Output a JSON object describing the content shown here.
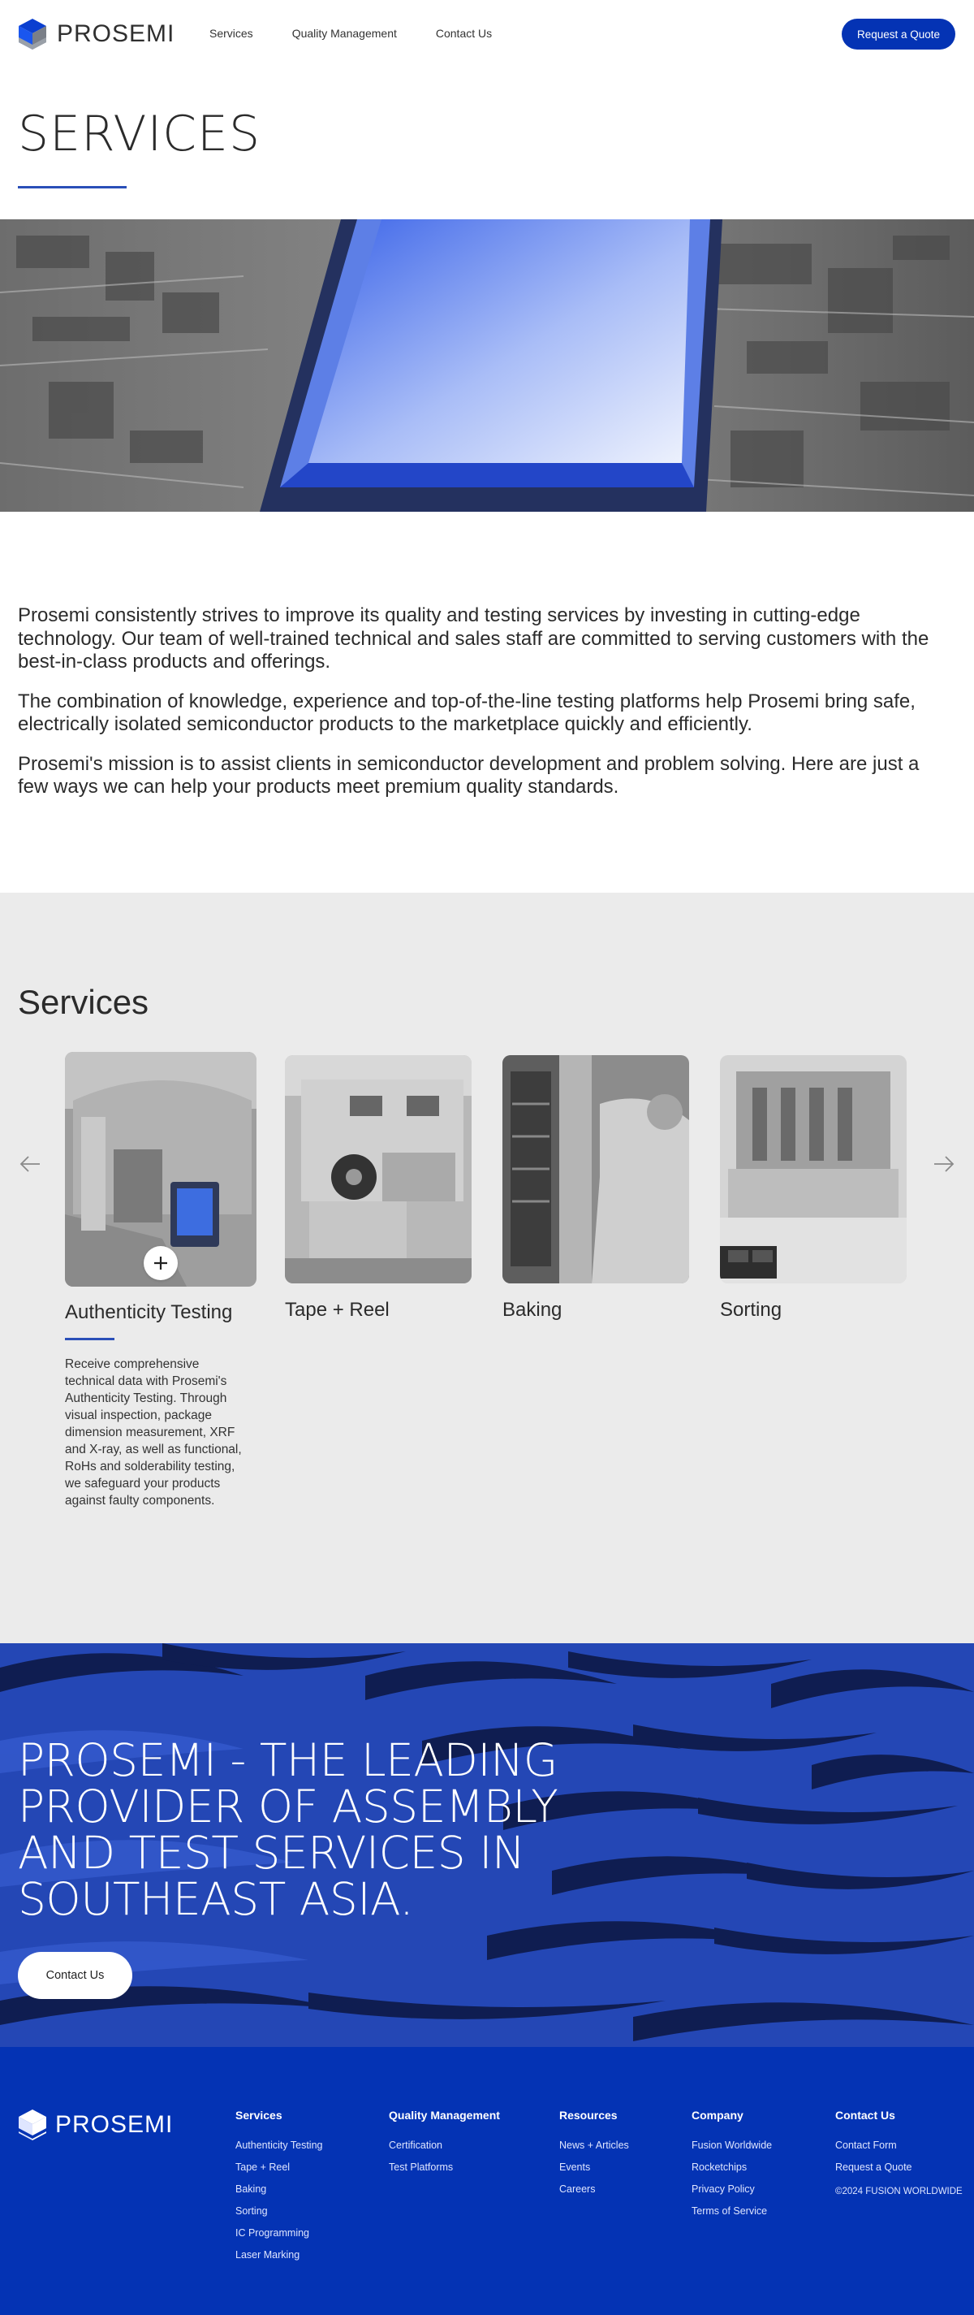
{
  "brand": {
    "name": "PROSEMI",
    "accent": "#0433b4",
    "rule_color": "#2a4fb8",
    "banner_color": "#2447b5"
  },
  "header": {
    "nav": [
      "Services",
      "Quality Management",
      "Contact Us"
    ],
    "cta_label": "Request a Quote"
  },
  "page": {
    "title": "SERVICES"
  },
  "intro": {
    "paragraphs": [
      "Prosemi consistently strives to improve its quality and testing services by investing in cutting-edge technology. Our team of well-trained technical and sales staff are committed to serving customers with the best-in-class products and offerings.",
      "The combination of knowledge, experience and top-of-the-line testing platforms help Prosemi bring safe, electrically isolated semiconductor products to the marketplace quickly and efficiently.",
      "Prosemi's mission is to assist clients in semiconductor development and problem solving. Here are just a few ways we can help your products meet premium quality standards."
    ]
  },
  "services": {
    "title": "Services",
    "cards": [
      {
        "title": "Authenticity Testing",
        "description": "Receive comprehensive technical data with Prosemi's Authenticity Testing. Through visual inspection, package dimension measurement, XRF and X-ray, as well as functional, RoHs and solderability testing, we safeguard your products against faulty components."
      },
      {
        "title": "Tape + Reel"
      },
      {
        "title": "Baking"
      },
      {
        "title": "Sorting"
      }
    ]
  },
  "banner": {
    "headline": "PROSEMI - THE LEADING PROVIDER OF ASSEMBLY AND TEST SERVICES IN SOUTHEAST ASIA.",
    "cta_label": "Contact Us"
  },
  "footer": {
    "columns": [
      {
        "heading": "Services",
        "links": [
          "Authenticity Testing",
          "Tape + Reel",
          "Baking",
          "Sorting",
          "IC Programming",
          "Laser Marking"
        ]
      },
      {
        "heading": "Quality Management",
        "links": [
          "Certification",
          "Test Platforms"
        ]
      },
      {
        "heading": "Resources",
        "links": [
          "News + Articles",
          "Events",
          "Careers"
        ]
      },
      {
        "heading": "Company",
        "links": [
          "Fusion Worldwide",
          "Rocketchips",
          "Privacy Policy",
          "Terms of Service"
        ]
      },
      {
        "heading": "Contact Us",
        "links": [
          "Contact Form",
          "Request a Quote"
        ]
      }
    ],
    "copyright": "©2024 FUSION WORLDWIDE"
  }
}
